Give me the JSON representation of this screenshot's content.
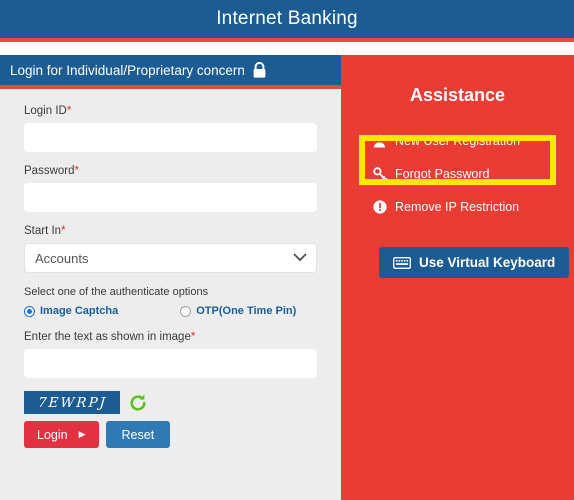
{
  "header": {
    "title": "Internet Banking"
  },
  "login_panel": {
    "panel_title": "Login for Individual/Proprietary concern",
    "lock_icon": "lock-icon",
    "fields": {
      "login_id_label": "Login ID",
      "login_id_value": "",
      "login_id_placeholder": "",
      "password_label": "Password",
      "password_value": "",
      "password_placeholder": "",
      "start_in_label": "Start In",
      "start_in_selected": "Accounts",
      "start_in_options": [
        "Accounts"
      ],
      "required_marker": "*"
    },
    "auth": {
      "hint": "Select one of the authenticate options",
      "option_image_captcha": "Image Captcha",
      "option_otp": "OTP(One Time Pin)",
      "selected": "Image Captcha"
    },
    "captcha": {
      "label": "Enter the text as shown in image",
      "input_value": "",
      "image_text": "7EWRPJ",
      "refresh_icon": "refresh-icon",
      "refresh_color": "#5dc11e"
    },
    "buttons": {
      "login": "Login",
      "login_caret": "▶",
      "reset": "Reset"
    }
  },
  "assistance": {
    "title": "Assistance",
    "links": [
      {
        "label": "New User Registration",
        "icon": "user-icon",
        "highlighted": true
      },
      {
        "label": "Forgot Password",
        "icon": "key-icon",
        "highlighted": false
      },
      {
        "label": "Remove IP Restriction",
        "icon": "exclamation-circle-icon",
        "highlighted": false
      }
    ],
    "virtual_keyboard_button": "Use Virtual Keyboard",
    "virtual_keyboard_icon": "keyboard-icon"
  },
  "colors": {
    "header_blue": "#1d5c92",
    "accent_red": "#e8483f",
    "panel_red": "#e83c34",
    "highlight_yellow": "#ffe800",
    "login_button_red": "#e23140",
    "reset_button_blue": "#2f7ab5",
    "field_bg": "#ededed"
  }
}
